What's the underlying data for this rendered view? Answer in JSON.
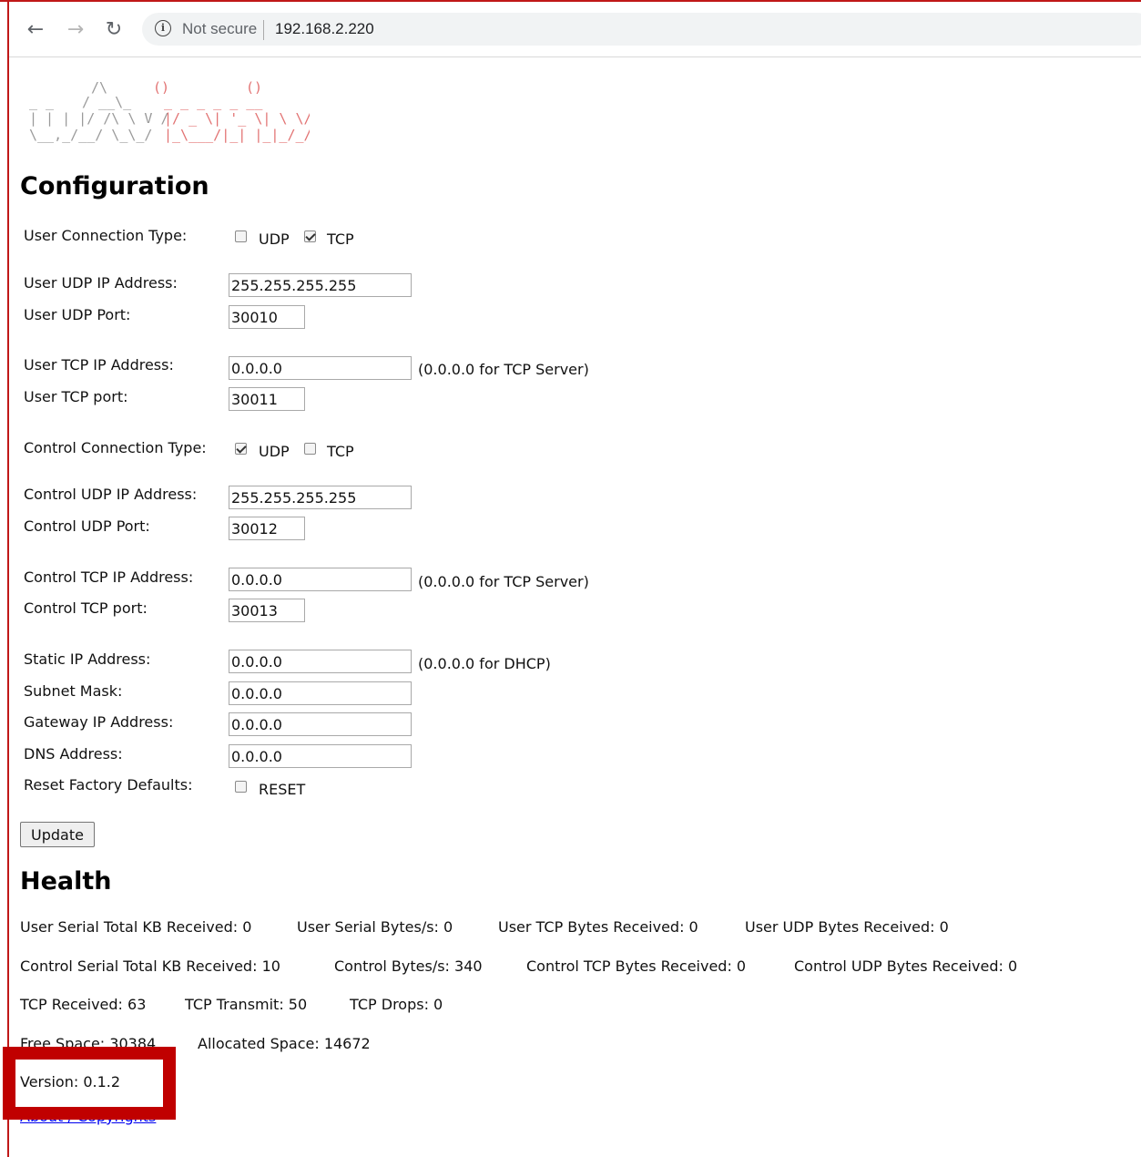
{
  "browser": {
    "security_label": "Not secure",
    "url": "192.168.2.220"
  },
  "logo": {
    "brand_text": "uAvionix",
    "ascii_lines": [
      "        /\\      ()     ()   ",
      " _  _  /  \\__ __  _  _  __ __",
      "| || |/ /\\ \\ V /| |/ \\| \\| \\ \\/ /",
      " \\_,_/_/  \\_\\_/ |_|\\_/|_|\\_|_/\\_\\"
    ]
  },
  "config": {
    "heading": "Configuration",
    "user_conn_type_label": "User Connection Type:",
    "user_conn_udp": {
      "label": "UDP",
      "checked": false
    },
    "user_conn_tcp": {
      "label": "TCP",
      "checked": true
    },
    "user_udp_ip_label": "User UDP IP Address:",
    "user_udp_ip_value": "255.255.255.255",
    "user_udp_port_label": "User UDP Port:",
    "user_udp_port_value": "30010",
    "user_tcp_ip_label": "User TCP IP Address:",
    "user_tcp_ip_value": "0.0.0.0",
    "user_tcp_ip_hint": "(0.0.0.0 for TCP Server)",
    "user_tcp_port_label": "User TCP port:",
    "user_tcp_port_value": "30011",
    "ctrl_conn_type_label": "Control Connection Type:",
    "ctrl_conn_udp": {
      "label": "UDP",
      "checked": true
    },
    "ctrl_conn_tcp": {
      "label": "TCP",
      "checked": false
    },
    "ctrl_udp_ip_label": "Control UDP IP Address:",
    "ctrl_udp_ip_value": "255.255.255.255",
    "ctrl_udp_port_label": "Control UDP Port:",
    "ctrl_udp_port_value": "30012",
    "ctrl_tcp_ip_label": "Control TCP IP Address:",
    "ctrl_tcp_ip_value": "0.0.0.0",
    "ctrl_tcp_ip_hint": "(0.0.0.0 for TCP Server)",
    "ctrl_tcp_port_label": "Control TCP port:",
    "ctrl_tcp_port_value": "30013",
    "static_ip_label": "Static IP Address:",
    "static_ip_value": "0.0.0.0",
    "static_ip_hint": "(0.0.0.0 for DHCP)",
    "subnet_label": "Subnet Mask:",
    "subnet_value": "0.0.0.0",
    "gateway_label": "Gateway IP Address:",
    "gateway_value": "0.0.0.0",
    "dns_label": "DNS Address:",
    "dns_value": "0.0.0.0",
    "reset_label": "Reset Factory Defaults:",
    "reset_cb": {
      "label": "RESET",
      "checked": false
    },
    "update_button": "Update"
  },
  "health": {
    "heading": "Health",
    "row1": [
      "User Serial Total KB Received: 0",
      "User Serial Bytes/s: 0",
      "User TCP Bytes Received: 0",
      "User UDP Bytes Received: 0"
    ],
    "row2": [
      "Control Serial Total KB Received: 10",
      "Control Bytes/s: 340",
      "Control TCP Bytes Received: 0",
      "Control UDP Bytes Received: 0"
    ],
    "row3": [
      "TCP Received: 63",
      "TCP Transmit: 50",
      "TCP Drops: 0"
    ],
    "row4": [
      "Free Space: 30384",
      "Allocated Space: 14672"
    ],
    "version": "Version: 0.1.2",
    "about_link": "About / Copyrights"
  },
  "colors": {
    "annotation_red": "#c00000",
    "logo_gray": "#9a9a9a",
    "logo_red": "#e27272",
    "link_blue": "#0000ee"
  }
}
